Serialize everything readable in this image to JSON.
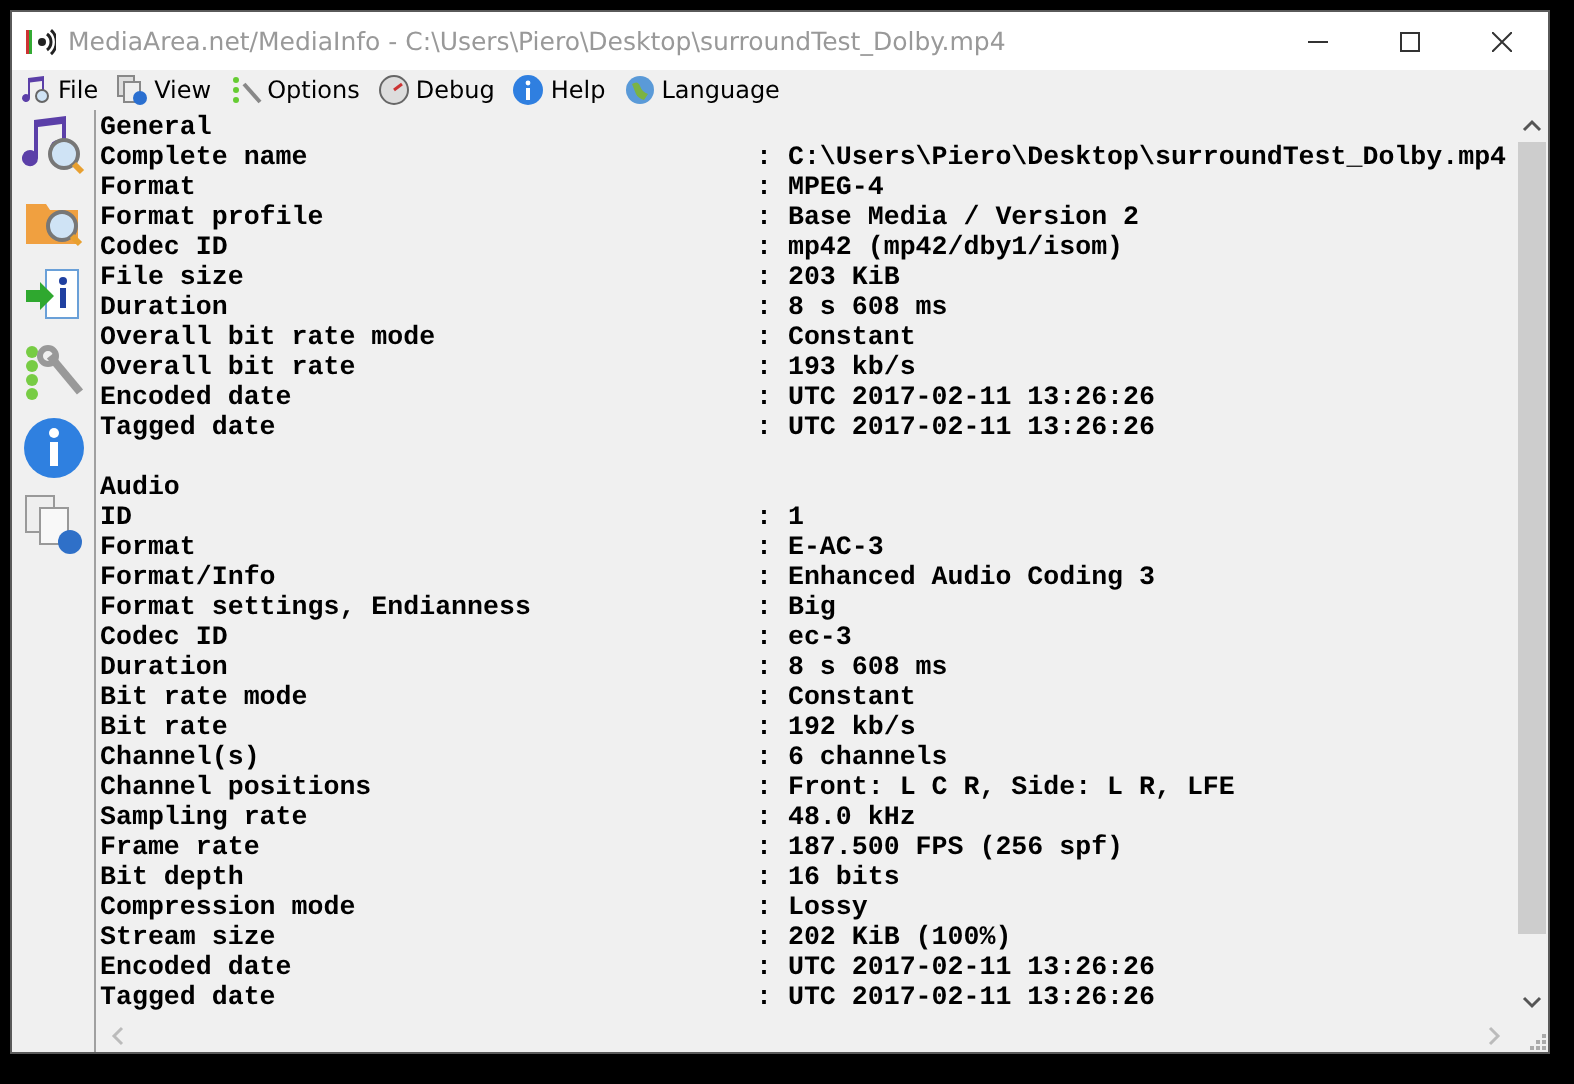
{
  "window": {
    "title": "MediaArea.net/MediaInfo - C:\\Users\\Piero\\Desktop\\surroundTest_Dolby.mp4"
  },
  "menu": [
    "File",
    "View",
    "Options",
    "Debug",
    "Help",
    "Language"
  ],
  "sections": [
    {
      "title": "General",
      "fields": [
        {
          "label": "Complete name",
          "value": ": C:\\Users\\Piero\\Desktop\\surroundTest_Dolby.mp4"
        },
        {
          "label": "Format",
          "value": ": MPEG-4"
        },
        {
          "label": "Format profile",
          "value": ": Base Media / Version 2"
        },
        {
          "label": "Codec ID",
          "value": ": mp42 (mp42/dby1/isom)"
        },
        {
          "label": "File size",
          "value": ": 203 KiB"
        },
        {
          "label": "Duration",
          "value": ": 8 s 608 ms"
        },
        {
          "label": "Overall bit rate mode",
          "value": ": Constant"
        },
        {
          "label": "Overall bit rate",
          "value": ": 193 kb/s"
        },
        {
          "label": "Encoded date",
          "value": ": UTC 2017-02-11 13:26:26"
        },
        {
          "label": "Tagged date",
          "value": ": UTC 2017-02-11 13:26:26"
        }
      ]
    },
    {
      "title": "Audio",
      "fields": [
        {
          "label": "ID",
          "value": ": 1"
        },
        {
          "label": "Format",
          "value": ": E-AC-3"
        },
        {
          "label": "Format/Info",
          "value": ": Enhanced Audio Coding 3"
        },
        {
          "label": "Format settings, Endianness",
          "value": ": Big"
        },
        {
          "label": "Codec ID",
          "value": ": ec-3"
        },
        {
          "label": "Duration",
          "value": ": 8 s 608 ms"
        },
        {
          "label": "Bit rate mode",
          "value": ": Constant"
        },
        {
          "label": "Bit rate",
          "value": ": 192 kb/s"
        },
        {
          "label": "Channel(s)",
          "value": ": 6 channels"
        },
        {
          "label": "Channel positions",
          "value": ": Front: L C R, Side: L R, LFE"
        },
        {
          "label": "Sampling rate",
          "value": ": 48.0 kHz"
        },
        {
          "label": "Frame rate",
          "value": ": 187.500 FPS (256 spf)"
        },
        {
          "label": "Bit depth",
          "value": ": 16 bits"
        },
        {
          "label": "Compression mode",
          "value": ": Lossy"
        },
        {
          "label": "Stream size",
          "value": ": 202 KiB (100%)"
        },
        {
          "label": "Encoded date",
          "value": ": UTC 2017-02-11 13:26:26"
        },
        {
          "label": "Tagged date",
          "value": ": UTC 2017-02-11 13:26:26"
        }
      ]
    }
  ]
}
